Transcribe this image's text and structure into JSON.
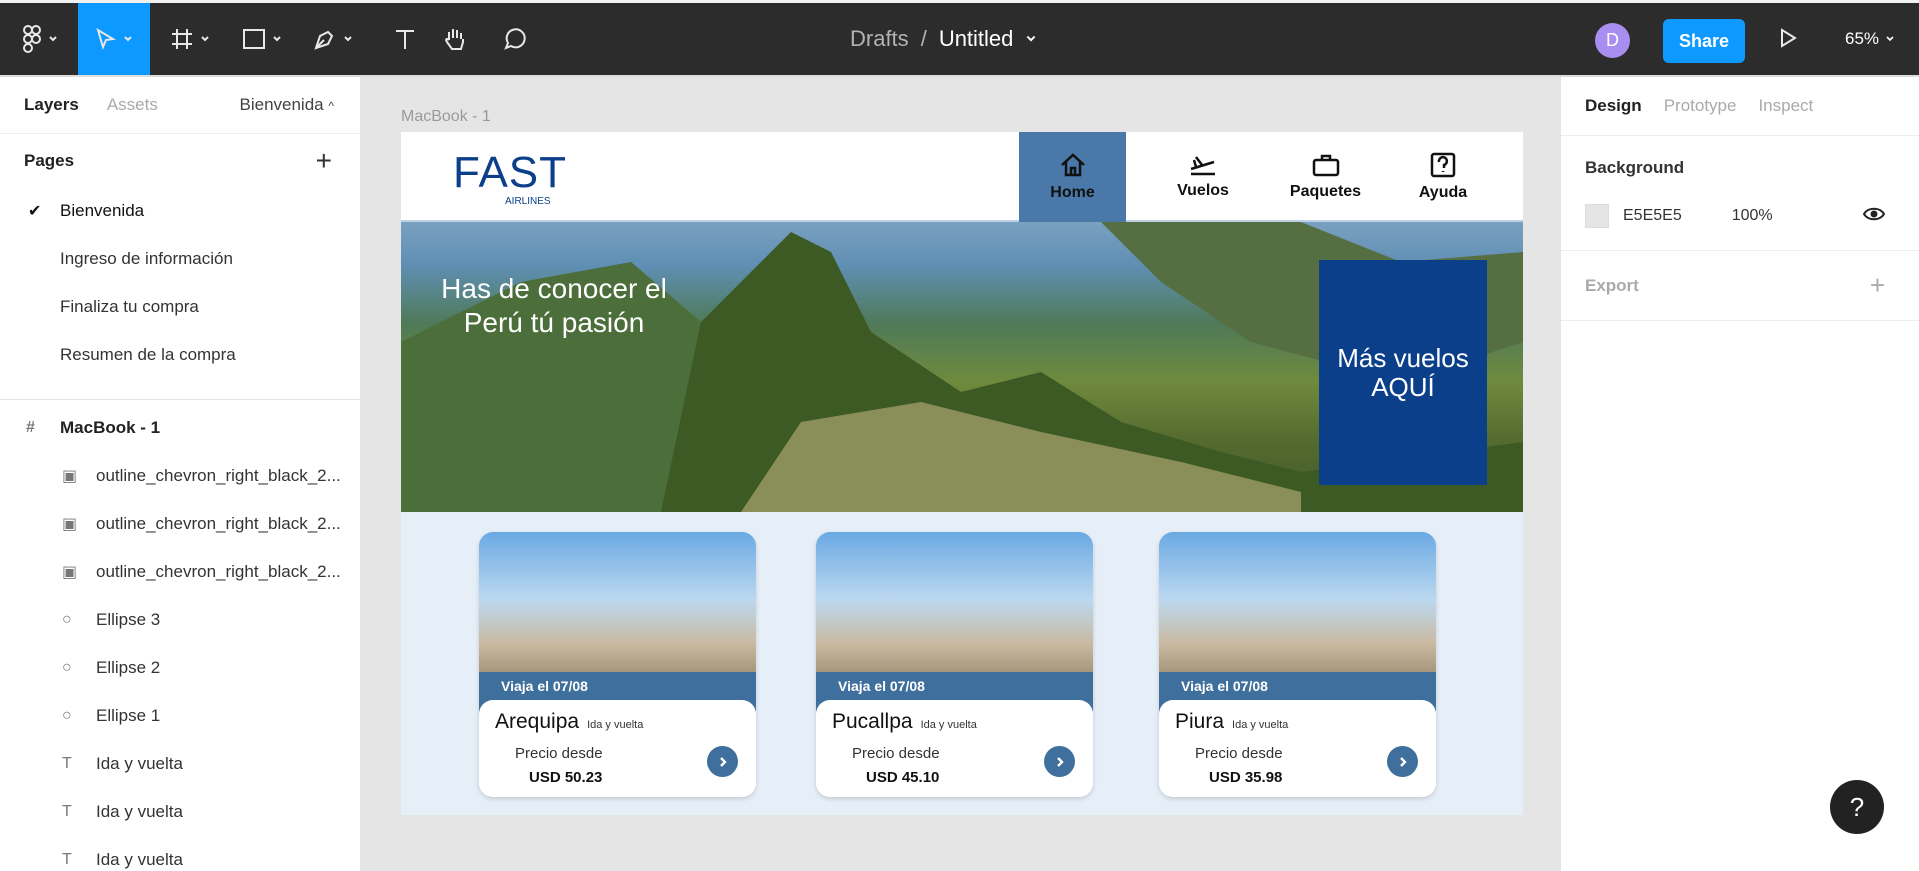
{
  "toolbar": {
    "breadcrumb_parent": "Drafts",
    "breadcrumb_sep": "/",
    "doc_title": "Untitled",
    "avatar_letter": "D",
    "share_label": "Share",
    "zoom": "65%"
  },
  "left_panel": {
    "tab_layers": "Layers",
    "tab_assets": "Assets",
    "current_page": "Bienvenida",
    "pages_label": "Pages",
    "pages": [
      "Bienvenida",
      "Ingreso de información",
      "Finaliza tu compra",
      "Resumen de la compra"
    ],
    "frame_name": "MacBook - 1",
    "layers": [
      {
        "icon": "image-icon",
        "name": "outline_chevron_right_black_2..."
      },
      {
        "icon": "image-icon",
        "name": "outline_chevron_right_black_2..."
      },
      {
        "icon": "image-icon",
        "name": "outline_chevron_right_black_2..."
      },
      {
        "icon": "ellipse-icon",
        "name": "Ellipse 3"
      },
      {
        "icon": "ellipse-icon",
        "name": "Ellipse 2"
      },
      {
        "icon": "ellipse-icon",
        "name": "Ellipse 1"
      },
      {
        "icon": "text-icon",
        "name": "Ida y vuelta"
      },
      {
        "icon": "text-icon",
        "name": "Ida y vuelta"
      },
      {
        "icon": "text-icon",
        "name": "Ida y vuelta"
      }
    ]
  },
  "canvas": {
    "frame_label": "MacBook - 1",
    "logo_big": "FAST",
    "logo_small": "AIRLINES",
    "nav": [
      "Home",
      "Vuelos",
      "Paquetes",
      "Ayuda"
    ],
    "hero_text": "Has de conocer el Perú tú pasión",
    "hero_cta": "Más vuelos AQUÍ",
    "cards": [
      {
        "date": "Viaja el 07/08",
        "city": "Arequipa",
        "kind": "Ida y vuelta",
        "from": "Precio desde",
        "price": "USD 50.23"
      },
      {
        "date": "Viaja el 07/08",
        "city": "Pucallpa",
        "kind": "Ida y vuelta",
        "from": "Precio desde",
        "price": "USD 45.10"
      },
      {
        "date": "Viaja el 07/08",
        "city": "Piura",
        "kind": "Ida y vuelta",
        "from": "Precio desde",
        "price": "USD 35.98"
      }
    ]
  },
  "right_panel": {
    "tabs": [
      "Design",
      "Prototype",
      "Inspect"
    ],
    "background_label": "Background",
    "bg_hex": "E5E5E5",
    "bg_opacity": "100%",
    "export_label": "Export"
  },
  "help_label": "?"
}
